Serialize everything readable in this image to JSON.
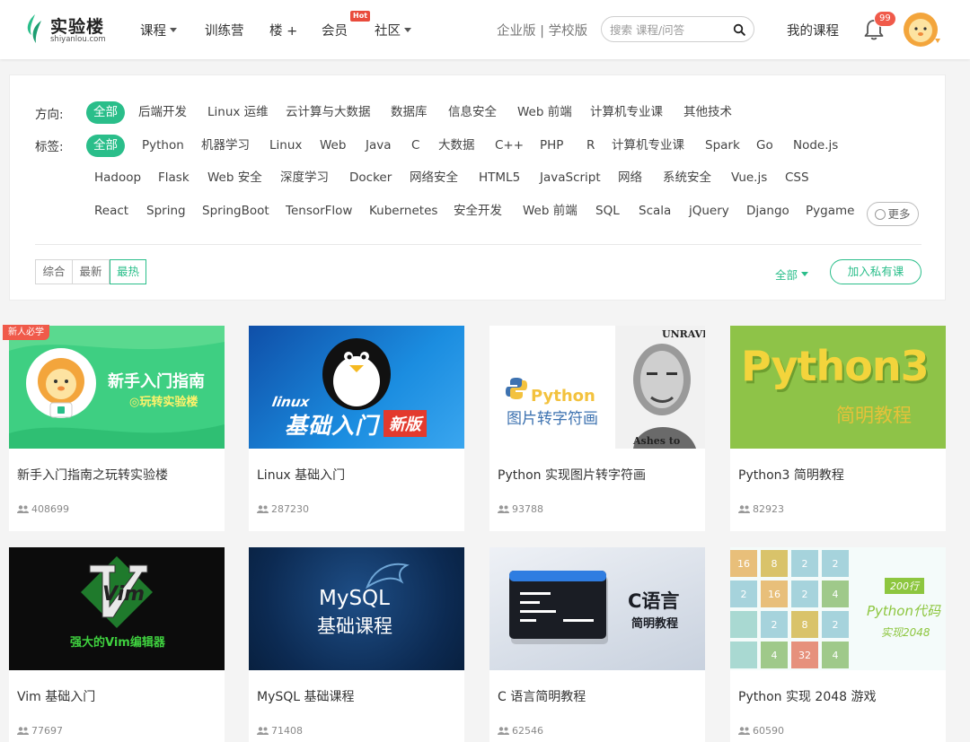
{
  "header": {
    "logo_cn": "实验楼",
    "logo_en": "shiyanlou.com",
    "nav": [
      {
        "label": "课程",
        "has_caret": true
      },
      {
        "label": "训练营",
        "has_caret": false
      },
      {
        "label": "楼 +",
        "has_caret": false
      },
      {
        "label": "会员",
        "has_caret": false
      },
      {
        "label": "社区",
        "has_caret": true
      }
    ],
    "hot_badge": "Hot",
    "enterprise": "企业版 | 学校版",
    "search_placeholder": "搜索 课程/问答",
    "my_course": "我的课程",
    "notification_count": "99",
    "accent_color": "#2abe8a"
  },
  "filter": {
    "direction_label": "方向:",
    "directions": [
      "全部",
      "后端开发",
      "Linux 运维",
      "云计算与大数据",
      "数据库",
      "信息安全",
      "Web 前端",
      "计算机专业课",
      "其他技术"
    ],
    "tags_label": "标签:",
    "tags_row1": [
      "全部",
      "Python",
      "机器学习",
      "Linux",
      "Web",
      "Java",
      "C",
      "大数据",
      "C++",
      "PHP",
      "R",
      "计算机专业课",
      "Spark",
      "Go",
      "Node.js"
    ],
    "tags_row2": [
      "Hadoop",
      "Flask",
      "Web 安全",
      "深度学习",
      "Docker",
      "网络安全",
      "HTML5",
      "JavaScript",
      "网络",
      "系统安全",
      "Vue.js",
      "CSS"
    ],
    "tags_row3": [
      "React",
      "Spring",
      "SpringBoot",
      "TensorFlow",
      "Kubernetes",
      "安全开发",
      "Web 前端",
      "SQL",
      "Scala",
      "jQuery",
      "Django",
      "Pygame"
    ],
    "more": "更多",
    "sort": [
      "综合",
      "最新",
      "最热"
    ],
    "sort_active": "最热",
    "all_dropdown": "全部",
    "join_private": "加入私有课"
  },
  "courses": [
    {
      "title": "新手入门指南之玩转实验楼",
      "count": "408699",
      "cover_text": "新手入门指南",
      "cover_sub": "◎玩转实验楼",
      "tag": "新人必学"
    },
    {
      "title": "Linux 基础入门",
      "count": "287230",
      "cover_text": "基础入门",
      "cover_sub": "新版",
      "cover_brand": "linux"
    },
    {
      "title": "Python 实现图片转字符画",
      "count": "93788",
      "cover_text": "Python",
      "cover_sub": "图片转字符画",
      "cover_brand": "UNRAVE",
      "cover_brand2": "Ashes to"
    },
    {
      "title": "Python3 简明教程",
      "count": "82923",
      "cover_text": "Python3",
      "cover_sub": "简明教程"
    },
    {
      "title": "Vim 基础入门",
      "count": "77697",
      "cover_text": "Vim",
      "cover_sub": "强大的Vim编辑器"
    },
    {
      "title": "MySQL 基础课程",
      "count": "71408",
      "cover_text": "MySQL",
      "cover_sub": "基础课程"
    },
    {
      "title": "C 语言简明教程",
      "count": "62546",
      "cover_text": "C语言",
      "cover_sub": "简明教程"
    },
    {
      "title": "Python 实现 2048 游戏",
      "count": "60590",
      "cover_text": "Python代码",
      "cover_sub": "实现2048",
      "cover_badge": "200行",
      "tiles": [
        "16",
        "8",
        "2",
        "2",
        "2",
        "16",
        "2",
        "4",
        "",
        "2",
        "8",
        "2",
        "",
        "4",
        "32",
        "4"
      ]
    }
  ]
}
